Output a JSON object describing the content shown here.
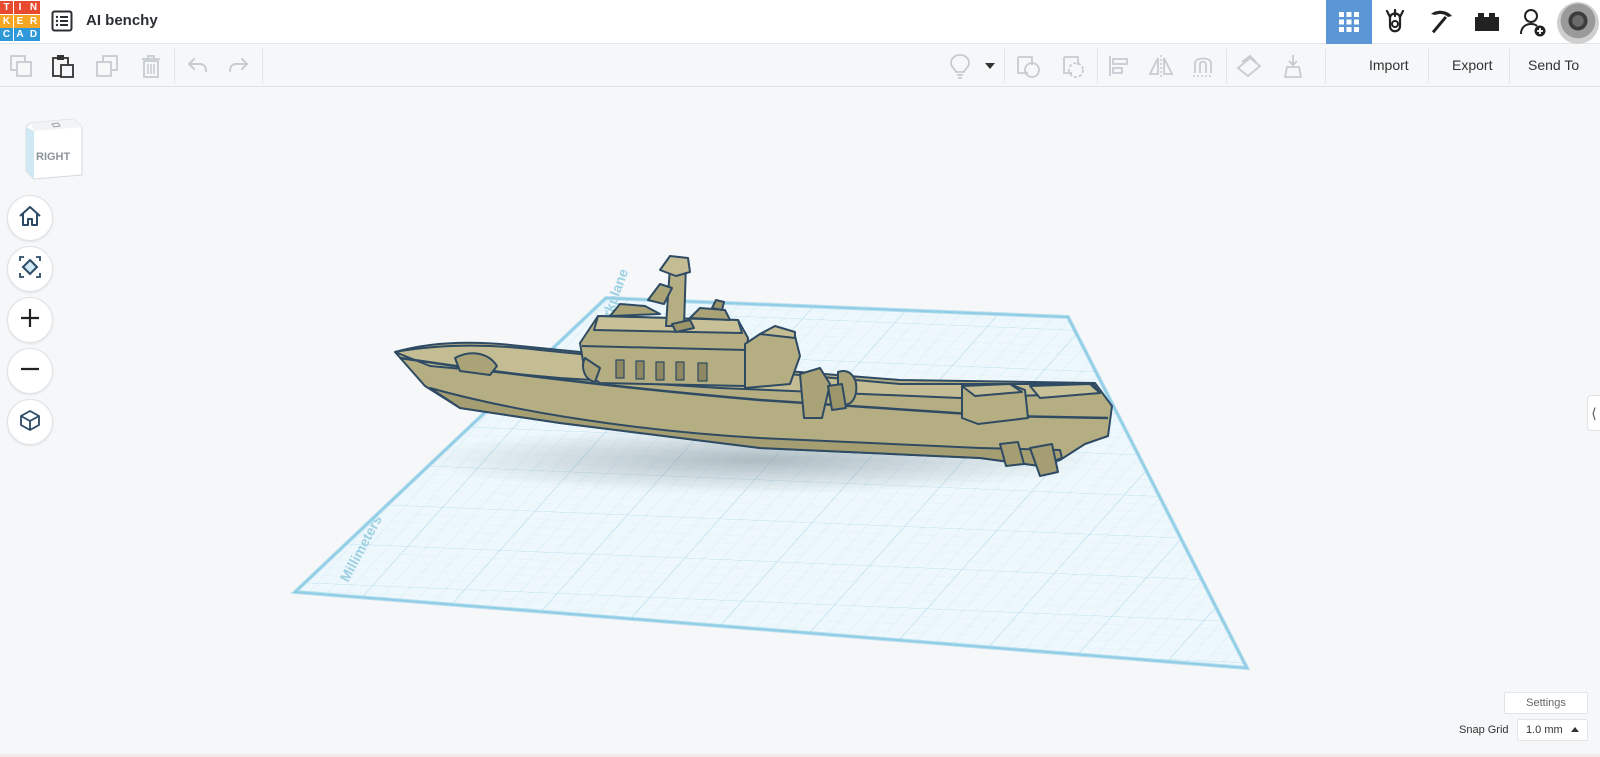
{
  "app": {
    "logo_letters": [
      "T",
      "I",
      "N",
      "K",
      "E",
      "R",
      "C",
      "A",
      "D"
    ],
    "logo_colors": [
      "#e84a2f",
      "#e84a2f",
      "#e84a2f",
      "#f5a623",
      "#f5a623",
      "#f5a623",
      "#2f98d8",
      "#2f98d8",
      "#2f98d8"
    ],
    "project_title": "AI benchy"
  },
  "topright": {
    "buttons": [
      {
        "name": "3d-design-grid-icon",
        "active": true
      },
      {
        "name": "codeblocks-icon",
        "active": false
      },
      {
        "name": "pickaxe-icon",
        "active": false
      },
      {
        "name": "bricks-icon",
        "active": false
      },
      {
        "name": "add-user-icon",
        "active": false
      }
    ]
  },
  "toolbar": {
    "icons_left": [
      "copy-icon",
      "paste-icon",
      "duplicate-icon",
      "delete-icon",
      "undo-icon",
      "redo-icon"
    ],
    "icons_right": [
      "light-bulb-icon",
      "dropdown-caret-icon",
      "solid-shape-icon",
      "hole-shape-icon",
      "align-icon",
      "mirror-icon",
      "cruise-icon",
      "workplane-icon",
      "drop-icon"
    ],
    "import_label": "Import",
    "export_label": "Export",
    "send_to_label": "Send To"
  },
  "viewcube": {
    "face_label": "RIGHT"
  },
  "nav": [
    "home-icon",
    "fit-all-icon",
    "zoom-in-icon",
    "zoom-out-icon",
    "perspective-cube-icon"
  ],
  "workplane": {
    "label_top": "Workplane",
    "label_left": "Millimeters",
    "accent": "#8fcde6"
  },
  "model": {
    "color": "#b5ae82",
    "outline": "#2f4b63"
  },
  "panel_toggle": "⟨",
  "footer": {
    "settings_label": "Settings",
    "snap_grid_label": "Snap Grid",
    "snap_grid_value": "1.0 mm"
  }
}
